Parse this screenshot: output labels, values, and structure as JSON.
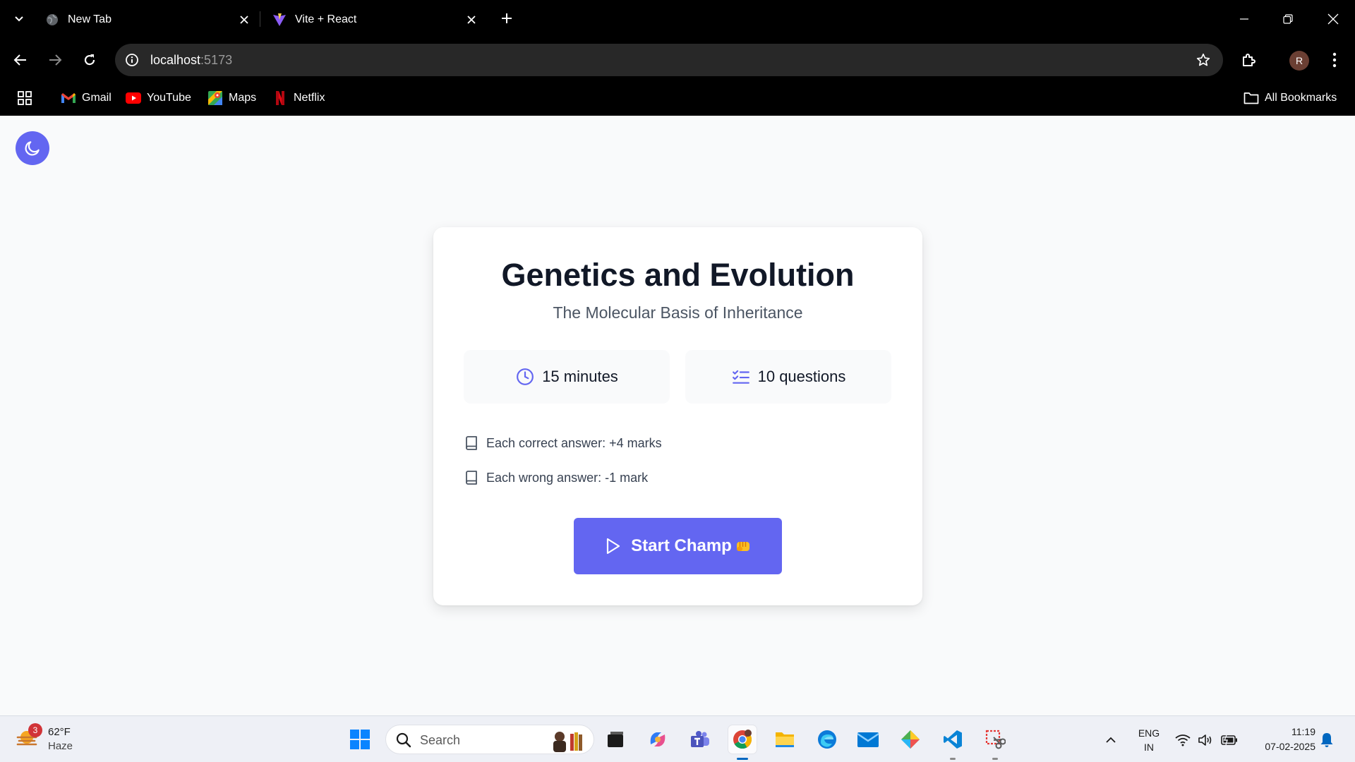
{
  "browser": {
    "tabs": [
      {
        "title": "New Tab",
        "icon": "globe-icon",
        "active": false
      },
      {
        "title": "Vite + React",
        "icon": "vite-icon",
        "active": true
      }
    ],
    "url": {
      "host": "localhost",
      "port": ":5173"
    },
    "bookmarks": [
      {
        "label": "Gmail",
        "icon": "gmail-icon"
      },
      {
        "label": "YouTube",
        "icon": "youtube-icon"
      },
      {
        "label": "Maps",
        "icon": "maps-icon"
      },
      {
        "label": "Netflix",
        "icon": "netflix-icon"
      }
    ],
    "all_bookmarks_label": "All Bookmarks",
    "profile_initial": "R"
  },
  "page": {
    "theme_toggle_icon": "moon-icon",
    "title": "Genetics and Evolution",
    "subtitle": "The Molecular Basis of Inheritance",
    "stats": {
      "time": "15 minutes",
      "questions": "10 questions"
    },
    "rules": [
      "Each correct answer: +4 marks",
      "Each wrong answer: -1 mark"
    ],
    "start_label": "Start Champ",
    "accent_color": "#6366f1"
  },
  "taskbar": {
    "weather": {
      "temp": "62°F",
      "condition": "Haze",
      "badge": "3"
    },
    "search_label": "Search",
    "lang": {
      "line1": "ENG",
      "line2": "IN"
    },
    "time": "11:19",
    "date": "07-02-2025"
  }
}
